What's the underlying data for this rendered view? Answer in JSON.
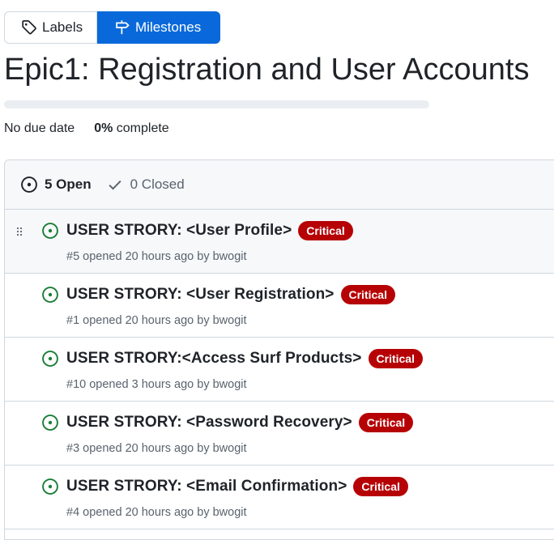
{
  "subnav": {
    "labels": {
      "label": "Labels",
      "icon": "tag-icon"
    },
    "milestones": {
      "label": "Milestones",
      "icon": "milestone-icon"
    }
  },
  "milestone": {
    "title": "Epic1: Registration and User Accounts",
    "due": "No due date",
    "percent": "0%",
    "percent_suffix": " complete",
    "progress_fraction": 0
  },
  "states": {
    "open": {
      "count_label": "5 Open",
      "icon": "issue-opened-icon"
    },
    "closed": {
      "count_label": "0 Closed",
      "icon": "check-icon"
    }
  },
  "issues": [
    {
      "title": "USER STRORY: <User Profile>",
      "label": "Critical",
      "meta": "#5 opened 20 hours ago by ",
      "author": "bwogit"
    },
    {
      "title": "USER STRORY: <User Registration>",
      "label": "Critical",
      "meta": "#1 opened 20 hours ago by ",
      "author": "bwogit"
    },
    {
      "title": "USER STRORY:<Access Surf Products>",
      "label": "Critical",
      "meta": "#10 opened 3 hours ago by ",
      "author": "bwogit"
    },
    {
      "title": "USER STRORY: <Password Recovery>",
      "label": "Critical",
      "meta": "#3 opened 20 hours ago by ",
      "author": "bwogit"
    },
    {
      "title": "USER STRORY: <Email Confirmation>",
      "label": "Critical",
      "meta": "#4 opened 20 hours ago by ",
      "author": "bwogit"
    }
  ],
  "colors": {
    "accent": "#0969da",
    "open": "#1a7f37",
    "label_critical": "#b60205"
  }
}
